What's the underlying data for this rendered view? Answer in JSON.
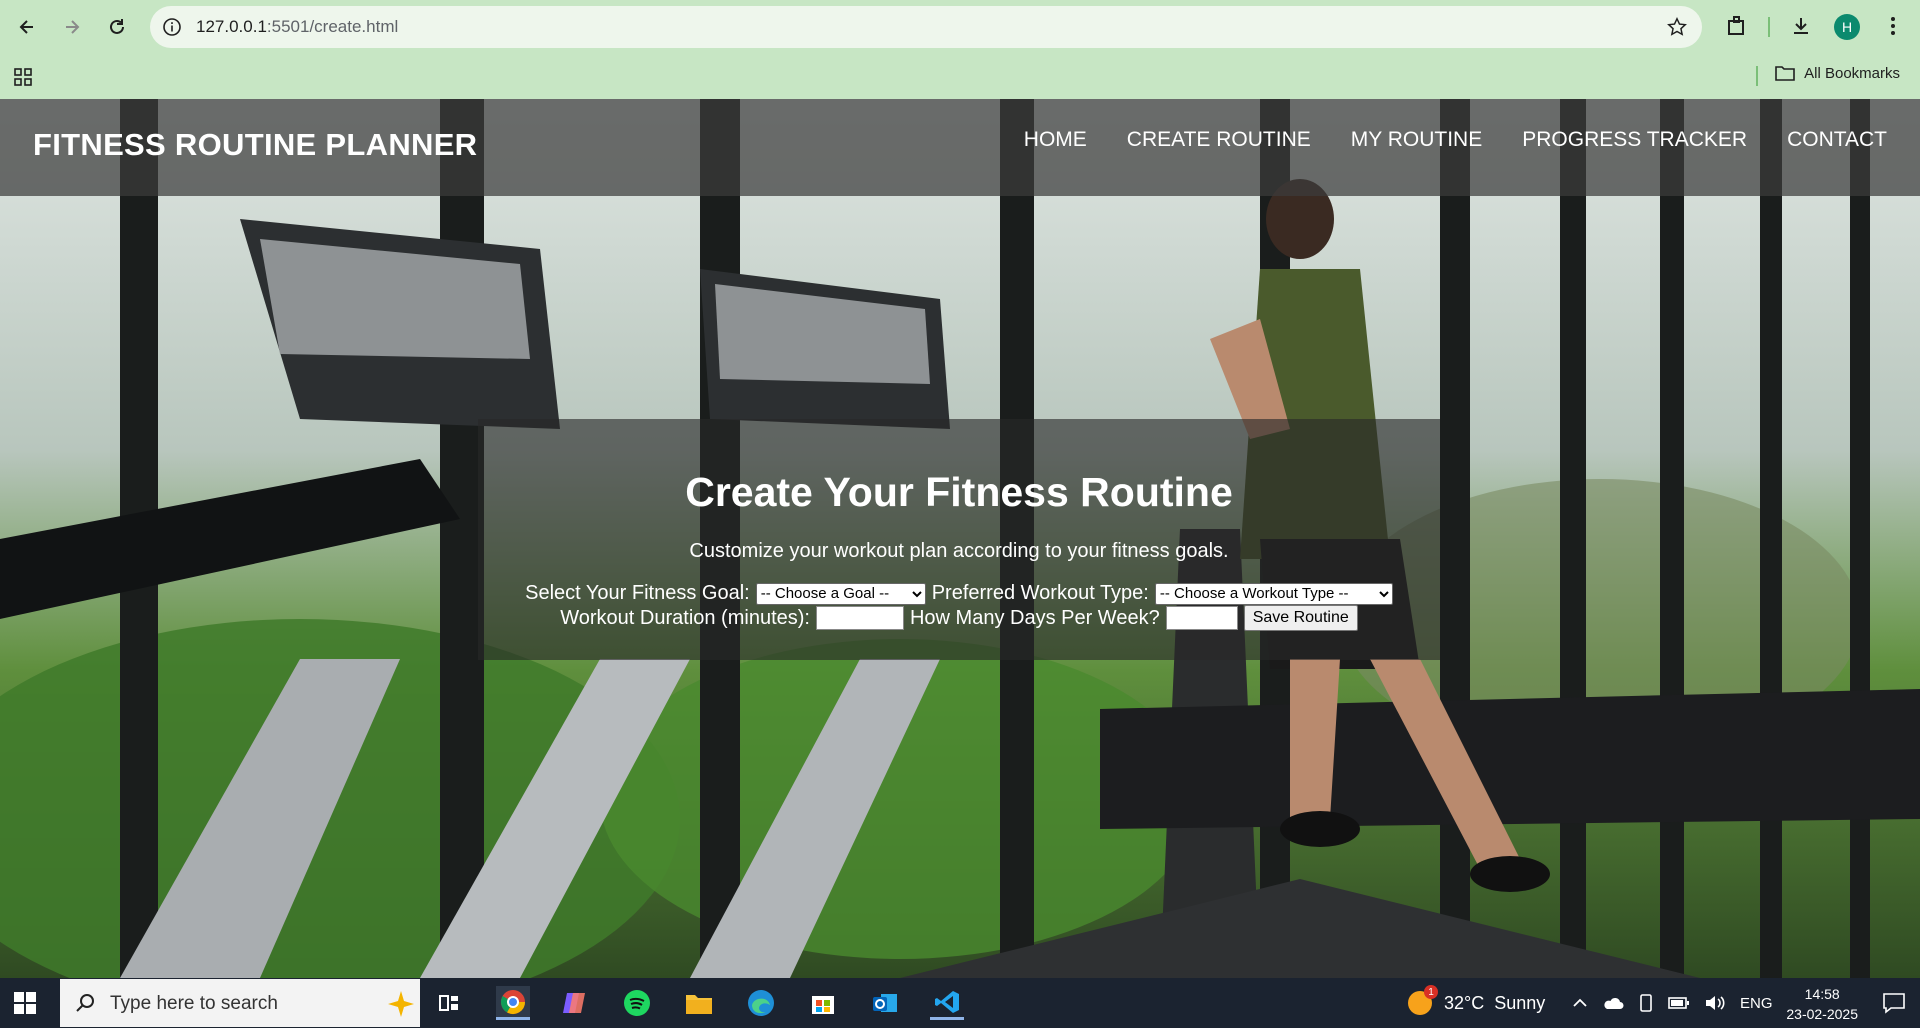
{
  "browser": {
    "url_host": "127.0.0.1",
    "url_rest": ":5501/create.html",
    "profile_initial": "H",
    "bookmarks_label": "All Bookmarks"
  },
  "site": {
    "brand": "FITNESS ROUTINE PLANNER",
    "nav": [
      "HOME",
      "CREATE ROUTINE",
      "MY ROUTINE",
      "PROGRESS TRACKER",
      "CONTACT"
    ]
  },
  "form": {
    "title": "Create Your Fitness Routine",
    "subtitle": "Customize your workout plan according to your fitness goals.",
    "goal_label": "Select Your Fitness Goal:",
    "goal_selected": "-- Choose a Goal --",
    "type_label": "Preferred Workout Type:",
    "type_selected": "-- Choose a Workout Type --",
    "duration_label": "Workout Duration (minutes):",
    "duration_value": "",
    "days_label": "How Many Days Per Week?",
    "days_value": "",
    "save_label": "Save Routine"
  },
  "taskbar": {
    "search_placeholder": "Type here to search",
    "weather_badge": "1",
    "weather": "32°C  Sunny",
    "lang": "ENG",
    "time": "14:58",
    "date": "23-02-2025"
  },
  "colors": {
    "chrome": "#c7e6c4",
    "header_overlay": "#3c3c3c",
    "taskbar": "#1b2330"
  }
}
